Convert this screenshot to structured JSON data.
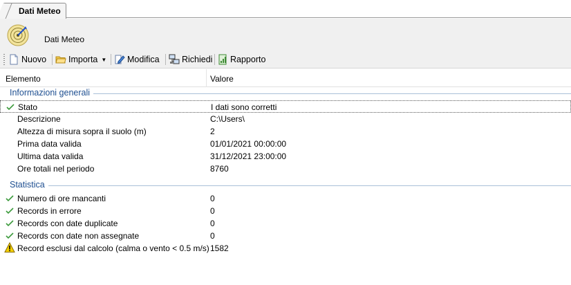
{
  "tab": {
    "label": "Dati Meteo"
  },
  "header": {
    "title": "Dati Meteo"
  },
  "toolbar": {
    "new_label": "Nuovo",
    "import_label": "Importa",
    "edit_label": "Modifica",
    "request_label": "Richiedi",
    "report_label": "Rapporto"
  },
  "columns": {
    "element": "Elemento",
    "value": "Valore"
  },
  "groups": {
    "general": "Informazioni generali",
    "stats": "Statistica"
  },
  "general_rows": [
    {
      "label": "Stato",
      "value": "I dati sono corretti",
      "icon": "check-icon"
    },
    {
      "label": "Descrizione",
      "value": "C:\\Users\\",
      "icon": ""
    },
    {
      "label": "Altezza di misura sopra il suolo (m)",
      "value": "2",
      "icon": ""
    },
    {
      "label": "Prima data valida",
      "value": "01/01/2021 00:00:00",
      "icon": ""
    },
    {
      "label": "Ultima data valida",
      "value": "31/12/2021 23:00:00",
      "icon": ""
    },
    {
      "label": "Ore totali nel periodo",
      "value": "8760",
      "icon": ""
    }
  ],
  "stats_rows": [
    {
      "label": "Numero di ore mancanti",
      "value": "0",
      "icon": "check-icon"
    },
    {
      "label": "Records in errore",
      "value": "0",
      "icon": "check-icon"
    },
    {
      "label": "Records con date duplicate",
      "value": "0",
      "icon": "check-icon"
    },
    {
      "label": "Records con date non assegnate",
      "value": "0",
      "icon": "check-icon"
    },
    {
      "label": "Record esclusi dal calcolo (calma o vento < 0.5 m/s)",
      "value": "1582",
      "icon": "warning-icon"
    }
  ],
  "colors": {
    "group_text": "#1e4f91",
    "check": "#3c9a3c",
    "warning": "#f4d000"
  }
}
